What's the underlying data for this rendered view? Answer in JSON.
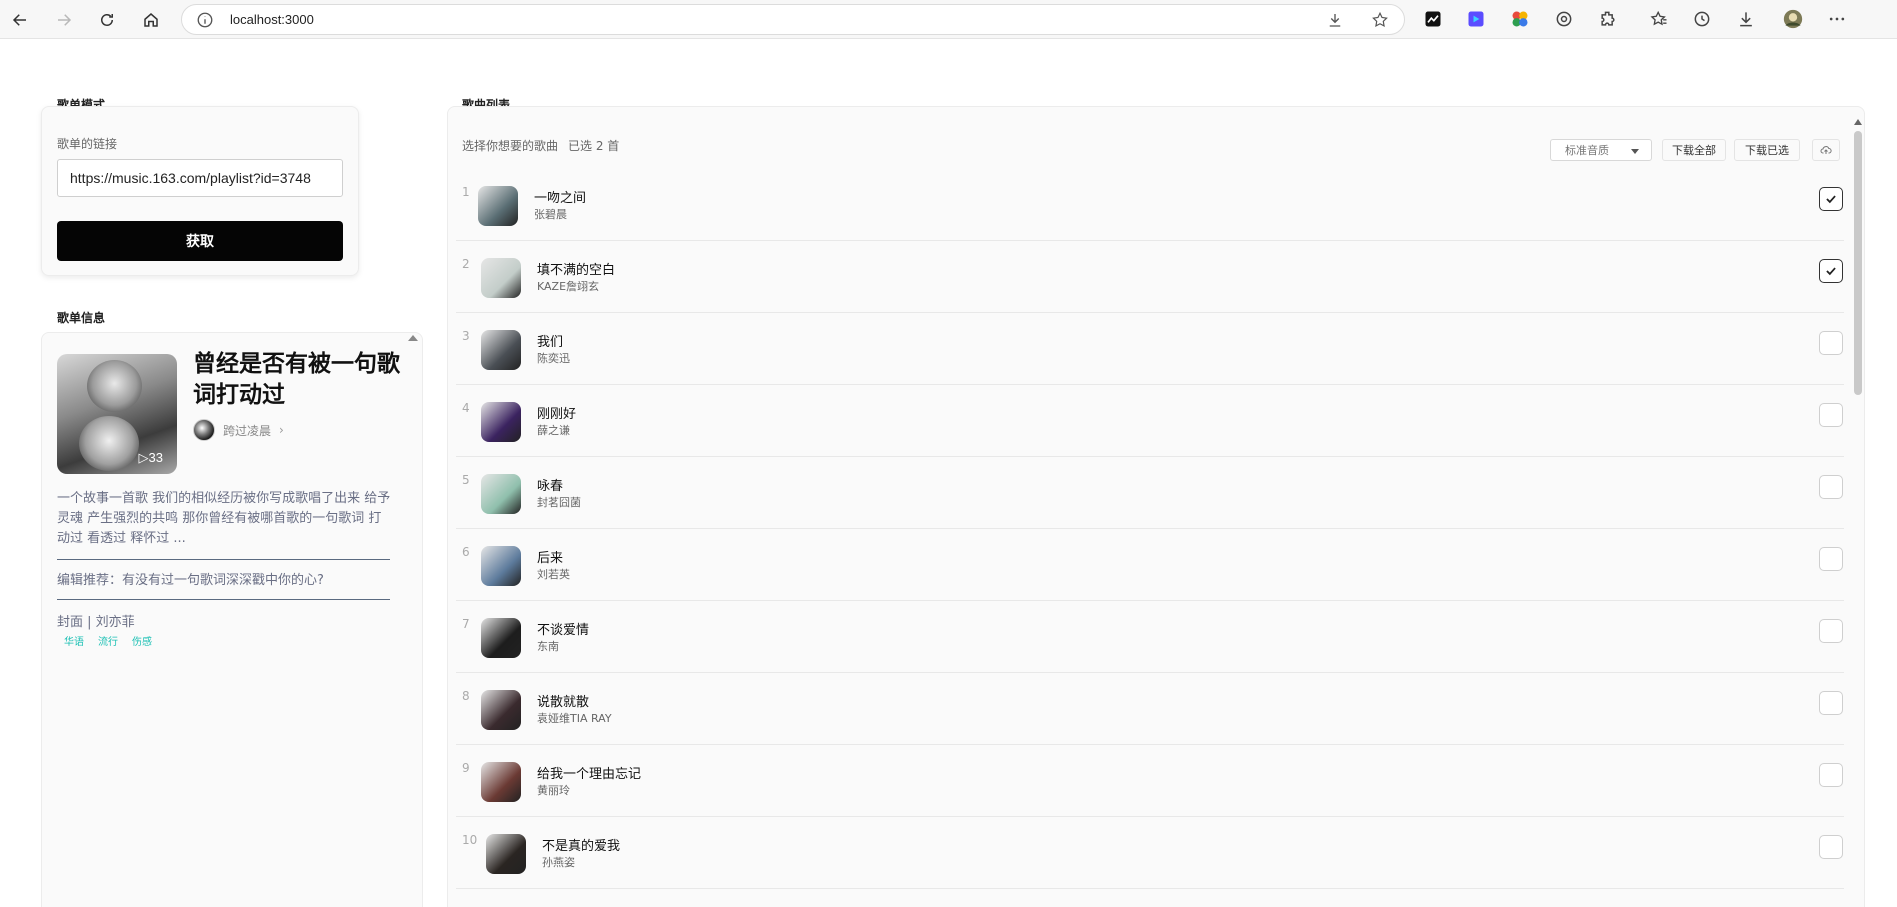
{
  "browser": {
    "url": "localhost:3000"
  },
  "left": {
    "mode_section_title": "歌单模式",
    "link_label": "歌单的链接",
    "link_value": "https://music.163.com/playlist?id=3748",
    "fetch_button": "获取",
    "info_section_title": "歌单信息",
    "playlist": {
      "title": "曾经是否有被一句歌词打动过",
      "play_count": "33",
      "creator": "跨过凌晨",
      "description": "一个故事一首歌 我们的相似经历被你写成歌唱了出来 给予灵魂 产生强烈的共鸣 那你曾经有被哪首歌的一句歌词 打动过 看透过 释怀过 ...",
      "recommendation": "编辑推荐：有没有过一句歌词深深戳中你的心?",
      "cover_credit": "封面 | 刘亦菲",
      "tags": [
        "华语",
        "流行",
        "伤感"
      ]
    }
  },
  "right": {
    "section_title": "歌曲列表",
    "hint": "选择你想要的歌曲",
    "selected_text": "已选 2 首",
    "quality_selected": "标准音质",
    "download_all": "下载全部",
    "download_selected": "下载已选",
    "songs": [
      {
        "num": "1",
        "name": "一吻之间",
        "artist": "张碧晨",
        "checked": true,
        "thumb_color": "#5a6e74"
      },
      {
        "num": "2",
        "name": "填不满的空白",
        "artist": "KAZE詹翊玄",
        "checked": true,
        "thumb_color": "#c3cdc9"
      },
      {
        "num": "3",
        "name": "我们",
        "artist": "陈奕迅",
        "checked": false,
        "thumb_color": "#4a4f55"
      },
      {
        "num": "4",
        "name": "刚刚好",
        "artist": "薛之谦",
        "checked": false,
        "thumb_color": "#3b2360"
      },
      {
        "num": "5",
        "name": "咏春",
        "artist": "封茗囧菌",
        "checked": false,
        "thumb_color": "#8fbfac"
      },
      {
        "num": "6",
        "name": "后来",
        "artist": "刘若英",
        "checked": false,
        "thumb_color": "#5d7b9c"
      },
      {
        "num": "7",
        "name": "不谈爱情",
        "artist": "东南",
        "checked": false,
        "thumb_color": "#1d1d1d"
      },
      {
        "num": "8",
        "name": "说散就散",
        "artist": "袁娅维TIA RAY",
        "checked": false,
        "thumb_color": "#3a2a2e"
      },
      {
        "num": "9",
        "name": "给我一个理由忘记",
        "artist": "黄丽玲",
        "checked": false,
        "thumb_color": "#6b3a34"
      },
      {
        "num": "10",
        "name": "不是真的爱我",
        "artist": "孙燕姿",
        "checked": false,
        "thumb_color": "#2a2522"
      }
    ]
  }
}
